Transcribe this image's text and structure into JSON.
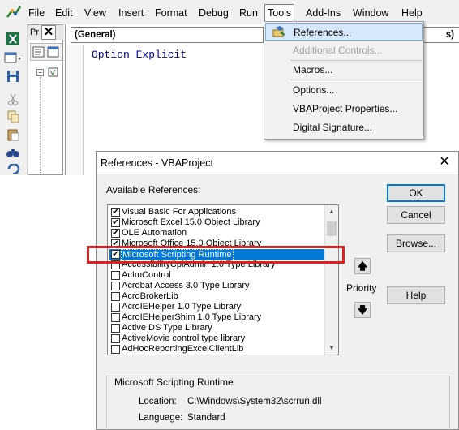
{
  "menubar": {
    "items": [
      "File",
      "Edit",
      "View",
      "Insert",
      "Format",
      "Debug",
      "Run",
      "Tools",
      "Add-Ins",
      "Window",
      "Help"
    ],
    "active": "Tools"
  },
  "project_pane": {
    "title": "Pr"
  },
  "code_window": {
    "object_combo": "(General)",
    "proc_combo_tail": "s)",
    "code": "Option Explicit"
  },
  "tools_menu": {
    "items": [
      {
        "label": "References...",
        "enabled": true,
        "highlighted": true,
        "icon": "references-icon"
      },
      {
        "label": "Additional Controls...",
        "enabled": false
      },
      {
        "label": "Macros...",
        "enabled": true
      },
      {
        "label": "Options...",
        "enabled": true
      },
      {
        "label": "VBAProject Properties...",
        "enabled": true
      },
      {
        "label": "Digital Signature...",
        "enabled": true
      }
    ]
  },
  "references_dialog": {
    "title": "References - VBAProject",
    "available_label": "Available References:",
    "references": [
      {
        "name": "Visual Basic For Applications",
        "checked": true
      },
      {
        "name": "Microsoft Excel 15.0 Object Library",
        "checked": true
      },
      {
        "name": "OLE Automation",
        "checked": true
      },
      {
        "name": "Microsoft Office 15.0 Object Library",
        "checked": true
      },
      {
        "name": "Microsoft Scripting Runtime",
        "checked": true,
        "selected": true
      },
      {
        "name": "AccessibilityCplAdmin 1.0 Type Library",
        "checked": false
      },
      {
        "name": "AcImControl",
        "checked": false
      },
      {
        "name": "Acrobat Access 3.0 Type Library",
        "checked": false
      },
      {
        "name": "AcroBrokerLib",
        "checked": false
      },
      {
        "name": "AcroIEHelper 1.0 Type Library",
        "checked": false
      },
      {
        "name": "AcroIEHelperShim 1.0 Type Library",
        "checked": false
      },
      {
        "name": "Active DS Type Library",
        "checked": false
      },
      {
        "name": "ActiveMovie control type library",
        "checked": false
      },
      {
        "name": "AdHocReportingExcelClientLib",
        "checked": false
      }
    ],
    "buttons": {
      "ok": "OK",
      "cancel": "Cancel",
      "browse": "Browse...",
      "help": "Help"
    },
    "priority_label": "Priority",
    "info": {
      "title": "Microsoft Scripting Runtime",
      "location_label": "Location:",
      "location": "C:\\Windows\\System32\\scrrun.dll",
      "language_label": "Language:",
      "language": "Standard"
    }
  },
  "colors": {
    "selection": "#0078d7",
    "highlight_box": "#e02020",
    "code_text": "#00008b",
    "menu_highlight": "#d7e8fa"
  }
}
